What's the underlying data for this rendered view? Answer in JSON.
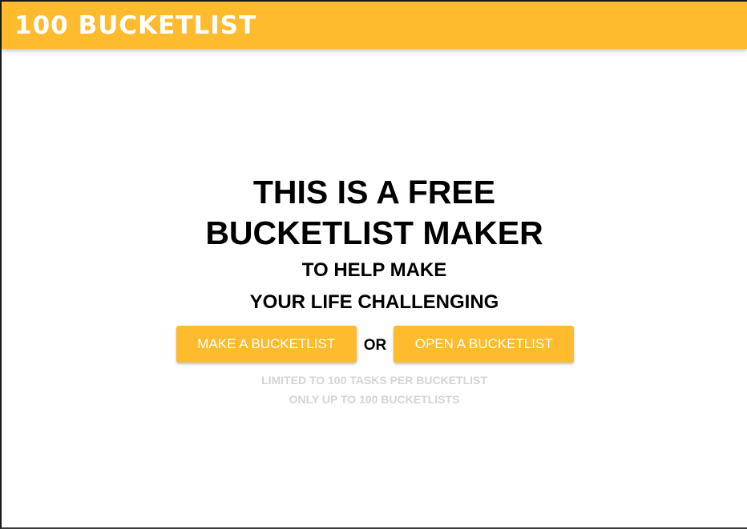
{
  "header": {
    "logo_text": "100 BUCKETLIST",
    "background_color": "#fdbb2d"
  },
  "hero": {
    "headline_line1": "THIS IS A FREE",
    "headline_line2": "BUCKETLIST MAKER",
    "subline1": "TO HELP MAKE",
    "subline2": "YOUR LIFE CHALLENGING"
  },
  "actions": {
    "make_label": "MAKE A BUCKETLIST",
    "or_label": "OR",
    "open_label": "OPEN A BUCKETLIST",
    "button_color": "#fdbb2d"
  },
  "notes": {
    "line1": "LIMITED TO 100 TASKS PER BUCKETLIST",
    "line2": "ONLY UP TO 100 BUCKETLISTS"
  }
}
